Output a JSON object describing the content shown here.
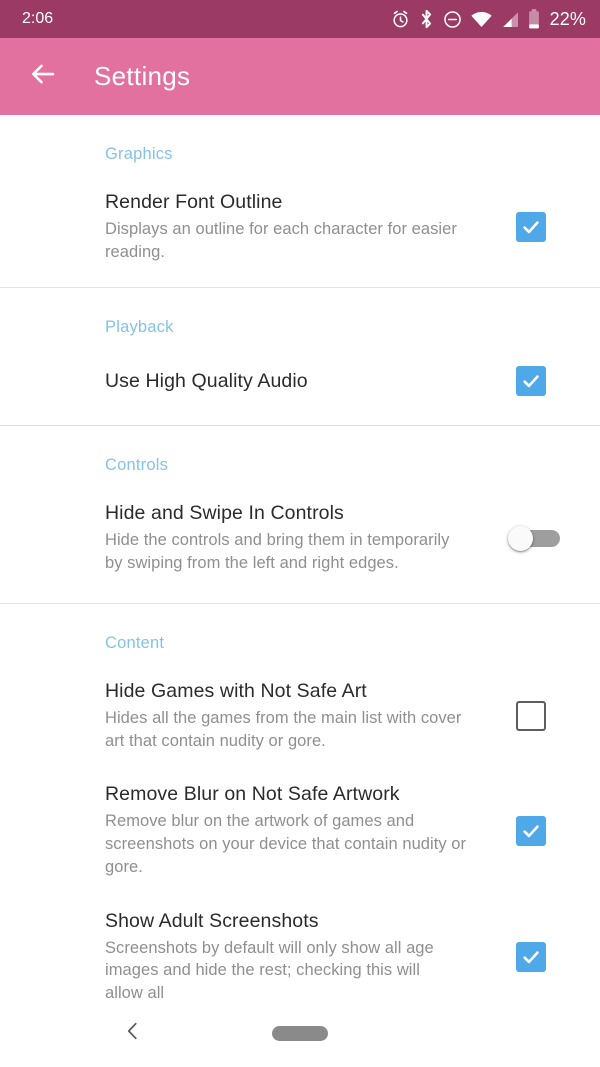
{
  "status_bar": {
    "time": "2:06",
    "battery_percent": "22%",
    "icons": [
      "alarm-icon",
      "bluetooth-icon",
      "do-not-disturb-icon",
      "wifi-icon",
      "cellular-signal-icon",
      "battery-icon"
    ]
  },
  "app_bar": {
    "back_label": "back-arrow-icon",
    "title": "Settings"
  },
  "colors": {
    "status_bar_bg": "#9c3a66",
    "app_bar_bg": "#e2719f",
    "section_header": "#84c2ea",
    "checkbox_checked": "#4fa9e9",
    "checkbox_unchecked_border": "#5e5e5e",
    "switch_track_off": "#9e9e9e",
    "switch_thumb_off": "#fafafa",
    "divider": "#e2e2e2",
    "title_text": "#2b2b2b",
    "summary_text": "#8f8f8f"
  },
  "sections": [
    {
      "header": "Graphics",
      "items": [
        {
          "title": "Render Font Outline",
          "summary": "Displays an outline for each character for easier reading.",
          "widget": "checkbox",
          "checked": true
        }
      ]
    },
    {
      "header": "Playback",
      "items": [
        {
          "title": "Use High Quality Audio",
          "summary": "",
          "widget": "checkbox",
          "checked": true
        }
      ]
    },
    {
      "header": "Controls",
      "items": [
        {
          "title": "Hide and Swipe In Controls",
          "summary": "Hide the controls and bring them in temporarily by swiping from the left and right edges.",
          "widget": "switch",
          "checked": false
        }
      ]
    },
    {
      "header": "Content",
      "items": [
        {
          "title": "Hide Games with Not Safe Art",
          "summary": "Hides all the games from the main list with cover art that contain nudity or gore.",
          "widget": "checkbox",
          "checked": false
        },
        {
          "title": "Remove Blur on Not Safe Artwork",
          "summary": "Remove blur on the artwork of games and screenshots on your device that contain nudity or gore.",
          "widget": "checkbox",
          "checked": true
        },
        {
          "title": "Show Adult Screenshots",
          "summary": "Screenshots by default will only show all age images and hide the rest; checking this will allow all",
          "widget": "checkbox",
          "checked": true
        }
      ]
    }
  ],
  "nav_bar": {
    "back": "nav-back-icon",
    "home": "nav-home-handle"
  }
}
